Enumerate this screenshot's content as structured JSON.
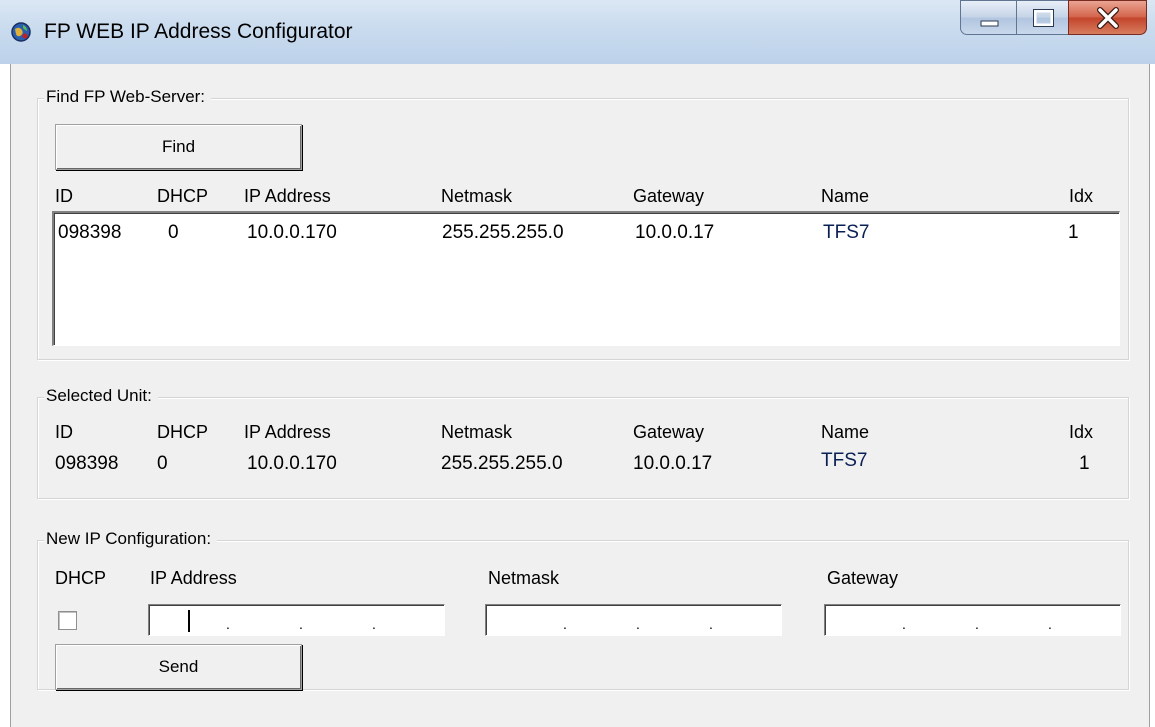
{
  "window": {
    "title": "FP WEB IP Address Configurator"
  },
  "find_group": {
    "legend": "Find FP Web-Server:",
    "find_button": "Find",
    "columns": [
      "ID",
      "DHCP",
      "IP Address",
      "Netmask",
      "Gateway",
      "Name",
      "Idx"
    ],
    "rows": [
      {
        "id": "098398",
        "dhcp": "0",
        "ip": "10.0.0.170",
        "netmask": "255.255.255.0",
        "gateway": "10.0.0.17",
        "name": "TFS7",
        "idx": "1"
      }
    ]
  },
  "selected_group": {
    "legend": "Selected Unit:",
    "columns": [
      "ID",
      "DHCP",
      "IP Address",
      "Netmask",
      "Gateway",
      "Name",
      "Idx"
    ],
    "unit": {
      "id": "098398",
      "dhcp": "0",
      "ip": "10.0.0.170",
      "netmask": "255.255.255.0",
      "gateway": "10.0.0.17",
      "name": "TFS7",
      "idx": "1"
    }
  },
  "new_config_group": {
    "legend": "New IP Configuration:",
    "dhcp_label": "DHCP",
    "ip_label": "IP Address",
    "netmask_label": "Netmask",
    "gateway_label": "Gateway",
    "dhcp_checked": false,
    "ip_value": "",
    "netmask_value": "",
    "gateway_value": "",
    "ip_separator": ".",
    "send_button": "Send"
  },
  "colors": {
    "name_text": "#0a1f54",
    "client_bg": "#f0f0f0"
  }
}
